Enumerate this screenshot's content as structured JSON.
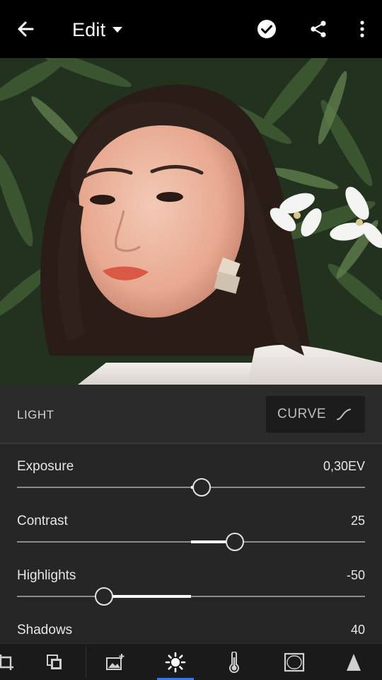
{
  "app_bar": {
    "title": "Edit",
    "icons": [
      "back-arrow-icon",
      "dropdown-caret-icon",
      "checkmark-icon",
      "share-icon",
      "more-vertical-icon"
    ]
  },
  "panel": {
    "section_title": "LIGHT",
    "curve_button_label": "CURVE",
    "sliders": [
      {
        "label": "Exposure",
        "value_text": "0,30EV",
        "value": 0.3,
        "min": -5,
        "max": 5
      },
      {
        "label": "Contrast",
        "value_text": "25",
        "value": 25,
        "min": -100,
        "max": 100
      },
      {
        "label": "Highlights",
        "value_text": "-50",
        "value": -50,
        "min": -100,
        "max": 100
      },
      {
        "label": "Shadows",
        "value_text": "40",
        "value": 40,
        "min": -100,
        "max": 100
      }
    ]
  },
  "toolbar": {
    "tools": [
      "crop-icon",
      "presets-icon",
      "auto-enhance-icon",
      "light-icon",
      "color-temperature-icon",
      "effects-vignette-icon",
      "detail-icon"
    ],
    "active_tool": "light-icon",
    "accent_color": "#2f78ff"
  }
}
